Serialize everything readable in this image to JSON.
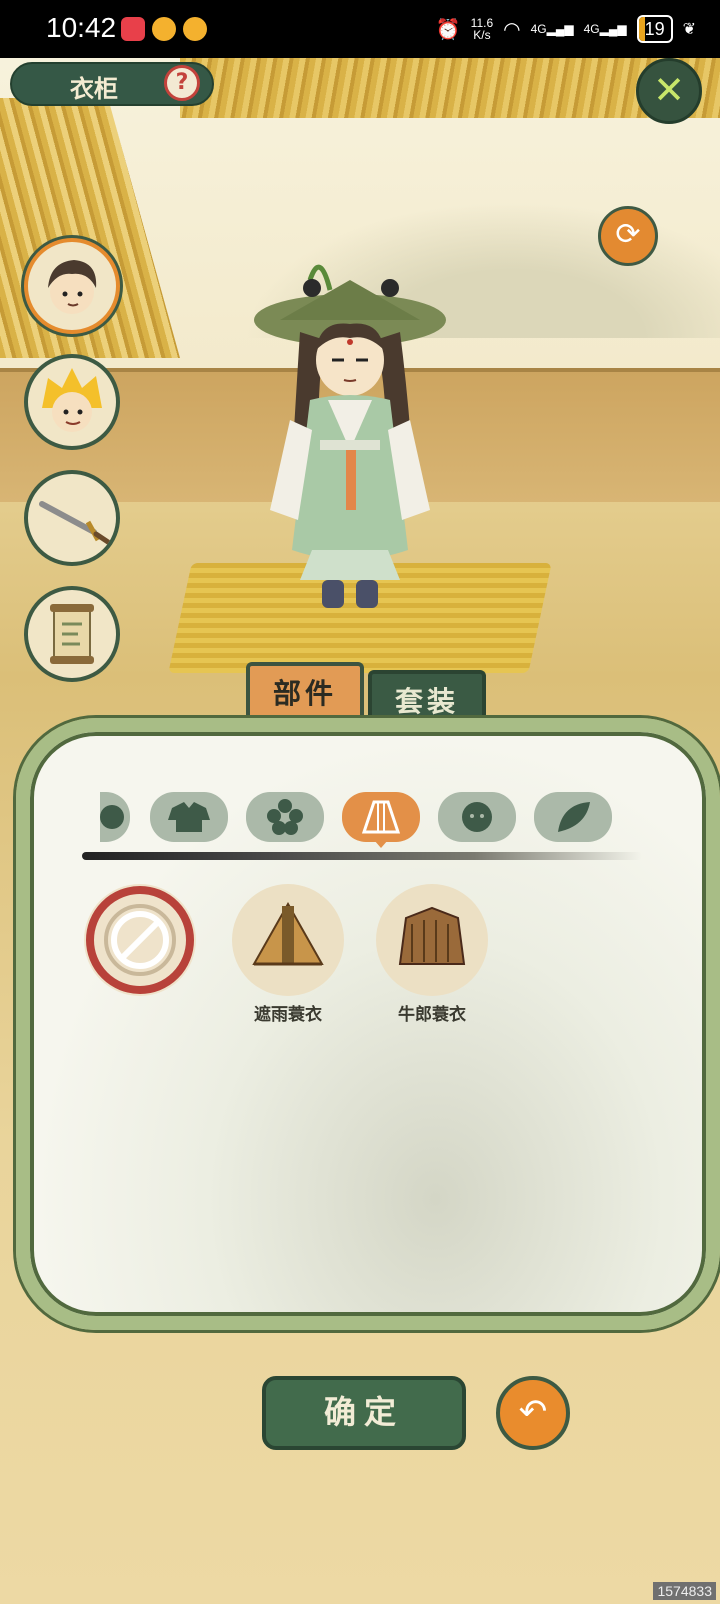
{
  "status_bar": {
    "time": "10:42",
    "net_speed_value": "11.6",
    "net_speed_unit": "K/s",
    "signal_1": "4G",
    "signal_2": "4G",
    "battery": "19"
  },
  "header": {
    "title": "衣柜",
    "help_icon": "question-mark-icon",
    "close_icon": "close-x-icon",
    "refresh_icon": "swap-arrows-icon"
  },
  "side_menu": {
    "items": [
      {
        "name": "character-portrait-1",
        "active": true
      },
      {
        "name": "character-portrait-2",
        "active": false
      },
      {
        "name": "sword",
        "active": false
      },
      {
        "name": "scroll",
        "active": false
      }
    ]
  },
  "tabs": {
    "parts_label": "部件",
    "sets_label": "套装",
    "selected": "部件"
  },
  "categories": {
    "items": [
      "hair",
      "clothing",
      "flower",
      "cape",
      "face",
      "leaf"
    ],
    "selected": "cape"
  },
  "items": [
    {
      "label": "",
      "icon": "none-slash-icon"
    },
    {
      "label": "遮雨蓑衣",
      "icon": "straw-raincoat-icon"
    },
    {
      "label": "牛郎蓑衣",
      "icon": "straw-cape-icon"
    }
  ],
  "footer": {
    "confirm_label": "确定",
    "undo_icon": "undo-arrow-icon"
  },
  "watermark": "1574833",
  "colors": {
    "accent_orange": "#e38a31",
    "dark_green": "#36533f",
    "panel_border": "#a8bd86"
  }
}
